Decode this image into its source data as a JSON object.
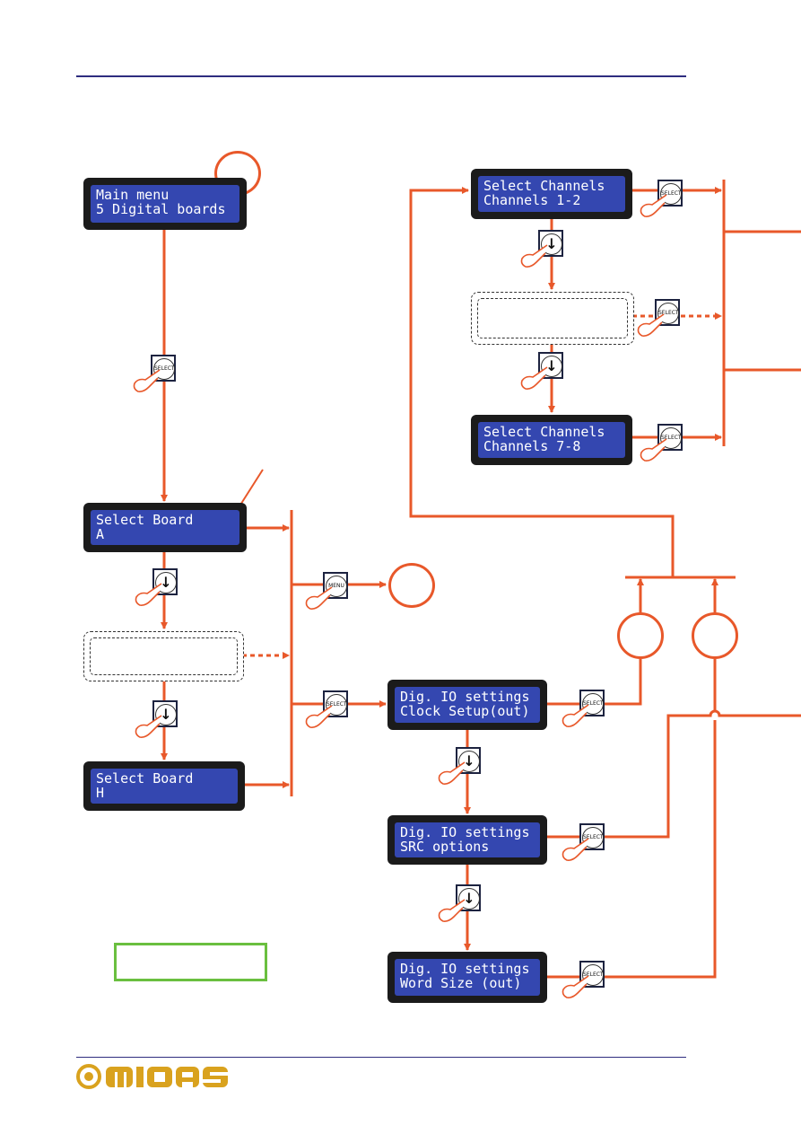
{
  "colors": {
    "flow": "#e8582a",
    "rule": "#2e2d7f",
    "lcd_screen": "#3447b0",
    "note_box": "#6abf3f",
    "logo": "#d9a21e"
  },
  "lcd": {
    "main_menu": [
      "Main menu",
      "5 Digital boards"
    ],
    "board_a": [
      "Select Board",
      "A"
    ],
    "board_h": [
      "Select Board",
      "H"
    ],
    "clock": [
      "Dig. IO settings",
      "Clock Setup(out)"
    ],
    "src": [
      "Dig. IO settings",
      "SRC options"
    ],
    "word": [
      "Dig. IO settings",
      "Word Size (out)"
    ],
    "ch12": [
      "Select Channels",
      "Channels 1-2"
    ],
    "ch78": [
      "Select Channels",
      "Channels 7-8"
    ]
  },
  "buttons": {
    "select": "SELECT",
    "menu": "MENU",
    "down": "↓"
  },
  "logo": {
    "text": "MIDAS"
  }
}
